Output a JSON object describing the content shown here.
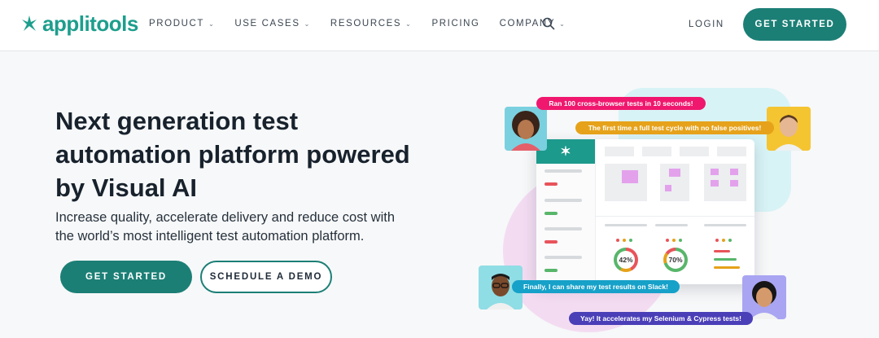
{
  "brand": {
    "name": "applitools",
    "accent": "#1c7f76",
    "logo_color": "#1d9e8d"
  },
  "nav": {
    "items": [
      {
        "label": "PRODUCT",
        "dropdown": true
      },
      {
        "label": "USE CASES",
        "dropdown": true
      },
      {
        "label": "RESOURCES",
        "dropdown": true
      },
      {
        "label": "PRICING",
        "dropdown": false
      },
      {
        "label": "COMPANY",
        "dropdown": true
      }
    ],
    "search_icon": "search-icon",
    "login_label": "LOGIN",
    "cta_label": "GET STARTED"
  },
  "hero": {
    "title": "Next generation test automation platform powered by Visual AI",
    "subtitle": "Increase quality, accelerate delivery and reduce cost with the world’s most intelligent test automation platform.",
    "primary_label": "GET STARTED",
    "secondary_label": "SCHEDULE A DEMO"
  },
  "illustration": {
    "bubbles": [
      {
        "text": "Ran 100 cross-browser tests in 10 seconds!",
        "color": "#f0186e"
      },
      {
        "text": "The first time a full test cycle with no false positives!",
        "color": "#e6a21a"
      },
      {
        "text": "Finally, I can share my test results on Slack!",
        "color": "#16a1c9"
      },
      {
        "text": "Yay! It accelerates my Selenium & Cypress tests!",
        "color": "#4b3fb8"
      }
    ],
    "donut_values": [
      "42%",
      "70%"
    ],
    "dashboard_logo": "✶"
  }
}
